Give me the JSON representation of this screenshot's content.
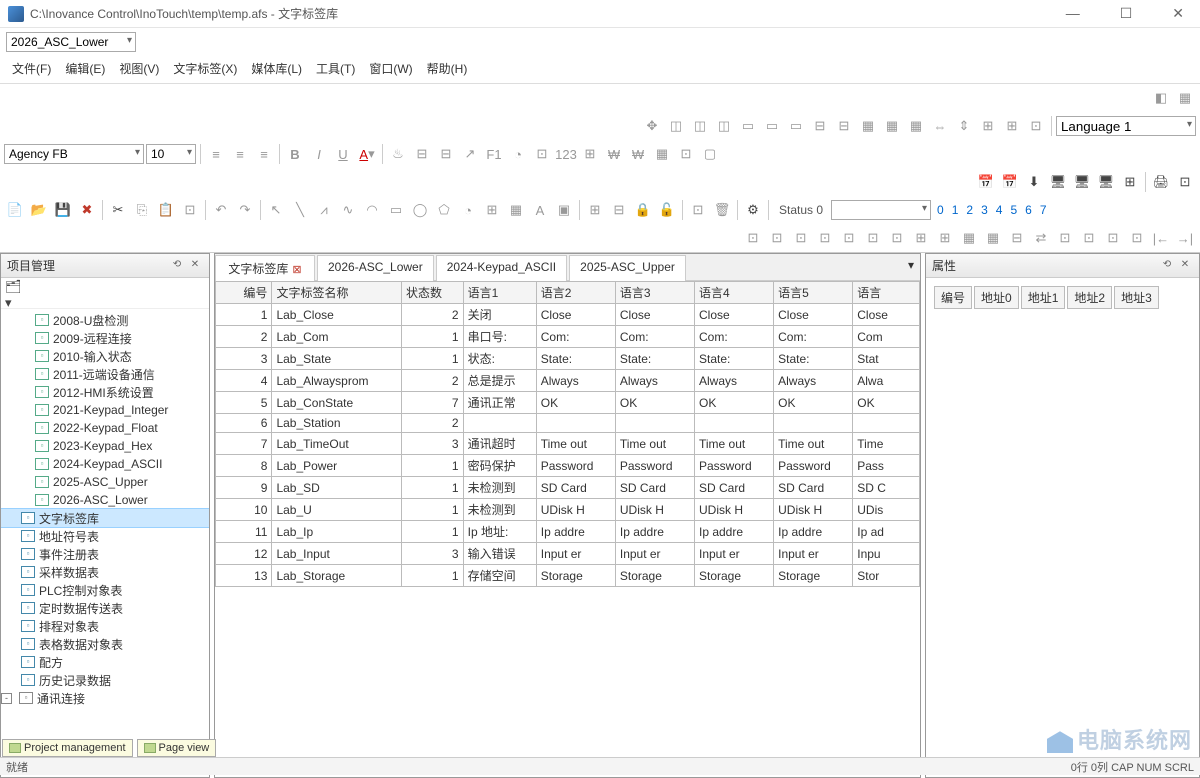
{
  "title": "C:\\Inovance Control\\InoTouch\\temp\\temp.afs - 文字标签库",
  "project_combo": "2026_ASC_Lower",
  "menus": [
    "文件(F)",
    "编辑(E)",
    "视图(V)",
    "文字标签(X)",
    "媒体库(L)",
    "工具(T)",
    "窗口(W)",
    "帮助(H)"
  ],
  "font": {
    "name": "Agency FB",
    "size": "10"
  },
  "language_combo": "Language 1",
  "status_text": "Status 0",
  "num_links": [
    "0",
    "1",
    "2",
    "3",
    "4",
    "5",
    "6",
    "7"
  ],
  "left_panel_title": "项目管理",
  "center_tabs": [
    {
      "label": "文字标签库",
      "active": true,
      "closable": true
    },
    {
      "label": "2026-ASC_Lower",
      "active": false
    },
    {
      "label": "2024-Keypad_ASCII",
      "active": false
    },
    {
      "label": "2025-ASC_Upper",
      "active": false
    }
  ],
  "right_panel_title": "属性",
  "tree": [
    {
      "label": "2008-U盘检测",
      "icon": "page",
      "lvl": 1
    },
    {
      "label": "2009-远程连接",
      "icon": "page",
      "lvl": 1
    },
    {
      "label": "2010-输入状态",
      "icon": "page",
      "lvl": 1
    },
    {
      "label": "2011-远端设备通信",
      "icon": "page",
      "lvl": 1
    },
    {
      "label": "2012-HMI系统设置",
      "icon": "page",
      "lvl": 1
    },
    {
      "label": "2021-Keypad_Integer",
      "icon": "page",
      "lvl": 1
    },
    {
      "label": "2022-Keypad_Float",
      "icon": "page",
      "lvl": 1
    },
    {
      "label": "2023-Keypad_Hex",
      "icon": "page",
      "lvl": 1
    },
    {
      "label": "2024-Keypad_ASCII",
      "icon": "page",
      "lvl": 1
    },
    {
      "label": "2025-ASC_Upper",
      "icon": "page",
      "lvl": 1
    },
    {
      "label": "2026-ASC_Lower",
      "icon": "page",
      "lvl": 1
    },
    {
      "label": "文字标签库",
      "icon": "db",
      "lvl": 0,
      "selected": true
    },
    {
      "label": "地址符号表",
      "icon": "db",
      "lvl": 0
    },
    {
      "label": "事件注册表",
      "icon": "db",
      "lvl": 0
    },
    {
      "label": "采样数据表",
      "icon": "db",
      "lvl": 0
    },
    {
      "label": "PLC控制对象表",
      "icon": "db",
      "lvl": 0
    },
    {
      "label": "定时数据传送表",
      "icon": "db",
      "lvl": 0
    },
    {
      "label": "排程对象表",
      "icon": "db",
      "lvl": 0
    },
    {
      "label": "表格数据对象表",
      "icon": "db",
      "lvl": 0
    },
    {
      "label": "配方",
      "icon": "db",
      "lvl": 0
    },
    {
      "label": "历史记录数据",
      "icon": "db",
      "lvl": 0
    },
    {
      "label": "通讯连接",
      "icon": "net",
      "lvl": 0,
      "expand": "-"
    }
  ],
  "table_headers": [
    "编号",
    "文字标签名称",
    "状态数",
    "语言1",
    "语言2",
    "语言3",
    "语言4",
    "语言5",
    "语言"
  ],
  "table_rows": [
    {
      "no": "1",
      "name": "Lab_Close",
      "states": "2",
      "l1": "关闭",
      "lx": "Close",
      "l6": "Close"
    },
    {
      "no": "2",
      "name": "Lab_Com",
      "states": "1",
      "l1": "串口号:",
      "lx": "Com:",
      "l6": "Com"
    },
    {
      "no": "3",
      "name": "Lab_State",
      "states": "1",
      "l1": "状态:",
      "lx": "State:",
      "l6": "Stat"
    },
    {
      "no": "4",
      "name": "Lab_Alwaysprom",
      "states": "2",
      "l1": "总是提示",
      "lx": "Always",
      "l6": "Alwa"
    },
    {
      "no": "5",
      "name": "Lab_ConState",
      "states": "7",
      "l1": "通讯正常",
      "lx": "OK",
      "l6": "OK"
    },
    {
      "no": "6",
      "name": "Lab_Station",
      "states": "2",
      "l1": "",
      "lx": "",
      "l6": ""
    },
    {
      "no": "7",
      "name": "Lab_TimeOut",
      "states": "3",
      "l1": "通讯超时",
      "lx": "Time out",
      "l6": "Time"
    },
    {
      "no": "8",
      "name": "Lab_Power",
      "states": "1",
      "l1": "密码保护",
      "lx": "Password",
      "l6": "Pass"
    },
    {
      "no": "9",
      "name": "Lab_SD",
      "states": "1",
      "l1": "未检测到",
      "lx": "SD Card",
      "l6": "SD C"
    },
    {
      "no": "10",
      "name": "Lab_U",
      "states": "1",
      "l1": "未检测到",
      "lx": "UDisk H",
      "l6": "UDis"
    },
    {
      "no": "11",
      "name": "Lab_Ip",
      "states": "1",
      "l1": "Ip 地址:",
      "lx": "Ip addre",
      "l6": "Ip ad"
    },
    {
      "no": "12",
      "name": "Lab_Input",
      "states": "3",
      "l1": "输入错误",
      "lx": "Input er",
      "l6": "Inpu"
    },
    {
      "no": "13",
      "name": "Lab_Storage",
      "states": "1",
      "l1": "存储空间",
      "lx": "Storage",
      "l6": "Stor"
    }
  ],
  "prop_headers": [
    "编号",
    "地址0",
    "地址1",
    "地址2",
    "地址3"
  ],
  "bottom_tabs": [
    "Project management",
    "Page view"
  ],
  "status_left": "就绪",
  "status_right": "0行 0列  CAP  NUM  SCRL",
  "watermark": "电脑系统网"
}
